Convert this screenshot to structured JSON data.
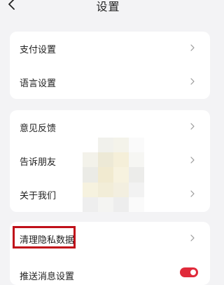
{
  "header": {
    "title": "设置",
    "back_icon": "chevron-left-icon"
  },
  "group1": {
    "items": [
      {
        "label": "支付设置"
      },
      {
        "label": "语言设置"
      }
    ]
  },
  "group2": {
    "items": [
      {
        "label": "意见反馈"
      },
      {
        "label": "告诉朋友"
      },
      {
        "label": "关于我们"
      }
    ]
  },
  "group3": {
    "items": [
      {
        "label": "清理隐私数据",
        "highlighted": true
      },
      {
        "label": "推送消息设置",
        "toggle_on": true
      }
    ]
  },
  "colors": {
    "background": "#f3f3f5",
    "card": "#ffffff",
    "highlight_border": "#c0101a",
    "toggle_on": "#e02a3a",
    "chevron": "#9a9a9a"
  },
  "mosaic_colors": [
    "#ffffff",
    "#f1f1ec",
    "#f4f3ea",
    "#fafafa",
    "#f3f2ea",
    "#ede9d6",
    "#f5efd9",
    "#f6f6f3",
    "#ebebe6",
    "#f1ead0",
    "#f7f2df",
    "#ececea",
    "#f6f2df",
    "#f2edd8",
    "#f3efe0",
    "#f2f2f2",
    "#eeeeee",
    "#f4f4f2",
    "#ededed",
    "#fafafa"
  ]
}
